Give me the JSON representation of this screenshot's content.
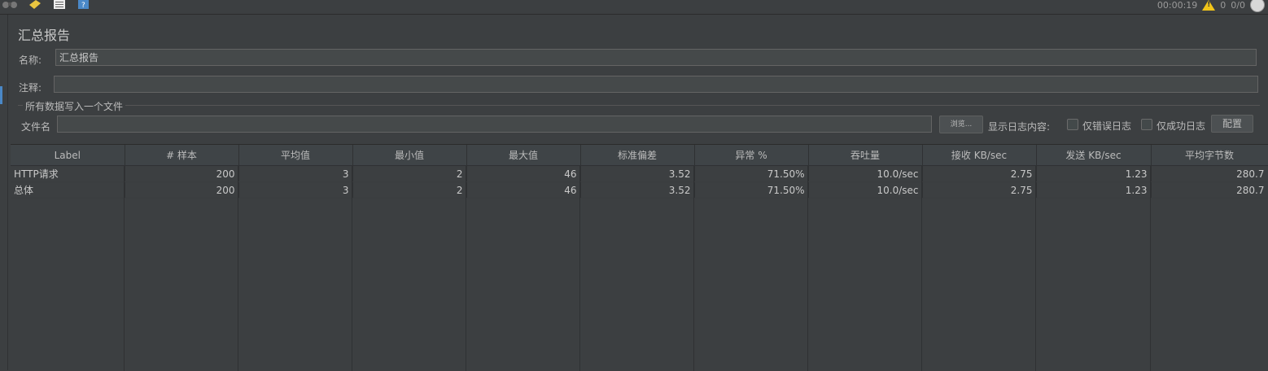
{
  "toolbar": {
    "timer": "00:00:19",
    "warning_count": "0",
    "threads": "0/0",
    "icons": [
      "binoculars-icon",
      "broom-icon",
      "list-icon",
      "help-icon"
    ]
  },
  "panel": {
    "title": "汇总报告",
    "name_label": "名称:",
    "name_value": "汇总报告",
    "comment_label": "注释:",
    "comment_value": "",
    "group_title": "所有数据写入一个文件",
    "filename_label": "文件名",
    "filename_value": "",
    "browse_label": "浏览...",
    "log_content_label": "显示日志内容:",
    "errors_only_label": "仅错误日志",
    "success_only_label": "仅成功日志",
    "configure_label": "配置"
  },
  "table": {
    "columns": [
      "Label",
      "# 样本",
      "平均值",
      "最小值",
      "最大值",
      "标准偏差",
      "异常 %",
      "吞吐量",
      "接收 KB/sec",
      "发送 KB/sec",
      "平均字节数"
    ],
    "rows": [
      [
        "HTTP请求",
        "200",
        "3",
        "2",
        "46",
        "3.52",
        "71.50%",
        "10.0/sec",
        "2.75",
        "1.23",
        "280.7"
      ],
      [
        "总体",
        "200",
        "3",
        "2",
        "46",
        "3.52",
        "71.50%",
        "10.0/sec",
        "2.75",
        "1.23",
        "280.7"
      ]
    ]
  },
  "colors": {
    "background": "#3c3f41",
    "field": "#45494a",
    "accent": "#4a88c7",
    "warning": "#f0c419"
  }
}
